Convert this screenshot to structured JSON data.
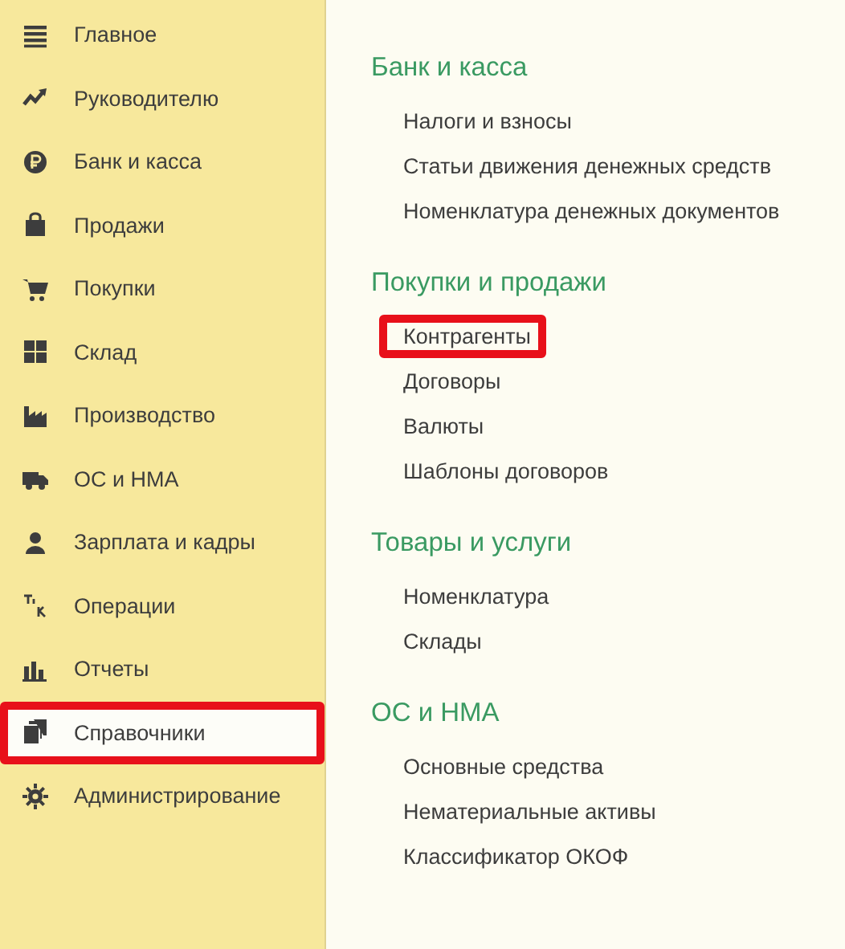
{
  "sidebar": {
    "items": [
      {
        "label": "Главное",
        "selected": false,
        "highlighted": false
      },
      {
        "label": "Руководителю",
        "selected": false,
        "highlighted": false
      },
      {
        "label": "Банк и касса",
        "selected": false,
        "highlighted": false
      },
      {
        "label": "Продажи",
        "selected": false,
        "highlighted": false
      },
      {
        "label": "Покупки",
        "selected": false,
        "highlighted": false
      },
      {
        "label": "Склад",
        "selected": false,
        "highlighted": false
      },
      {
        "label": "Производство",
        "selected": false,
        "highlighted": false
      },
      {
        "label": "ОС и НМА",
        "selected": false,
        "highlighted": false
      },
      {
        "label": "Зарплата и кадры",
        "selected": false,
        "highlighted": false
      },
      {
        "label": "Операции",
        "selected": false,
        "highlighted": false
      },
      {
        "label": "Отчеты",
        "selected": false,
        "highlighted": false
      },
      {
        "label": "Справочники",
        "selected": true,
        "highlighted": true
      },
      {
        "label": "Администрирование",
        "selected": false,
        "highlighted": false
      }
    ]
  },
  "sections": [
    {
      "title": "Банк и касса",
      "links": [
        {
          "label": "Налоги и взносы",
          "highlighted": false
        },
        {
          "label": "Статьи движения денежных средств",
          "highlighted": false
        },
        {
          "label": "Номенклатура денежных документов",
          "highlighted": false
        }
      ]
    },
    {
      "title": "Покупки и продажи",
      "links": [
        {
          "label": "Контрагенты",
          "highlighted": true
        },
        {
          "label": "Договоры",
          "highlighted": false
        },
        {
          "label": "Валюты",
          "highlighted": false
        },
        {
          "label": "Шаблоны договоров",
          "highlighted": false
        }
      ]
    },
    {
      "title": "Товары и услуги",
      "links": [
        {
          "label": "Номенклатура",
          "highlighted": false
        },
        {
          "label": "Склады",
          "highlighted": false
        }
      ]
    },
    {
      "title": "ОС и НМА",
      "links": [
        {
          "label": "Основные средства",
          "highlighted": false
        },
        {
          "label": "Нематериальные активы",
          "highlighted": false
        },
        {
          "label": "Классификатор ОКОФ",
          "highlighted": false
        }
      ]
    }
  ]
}
